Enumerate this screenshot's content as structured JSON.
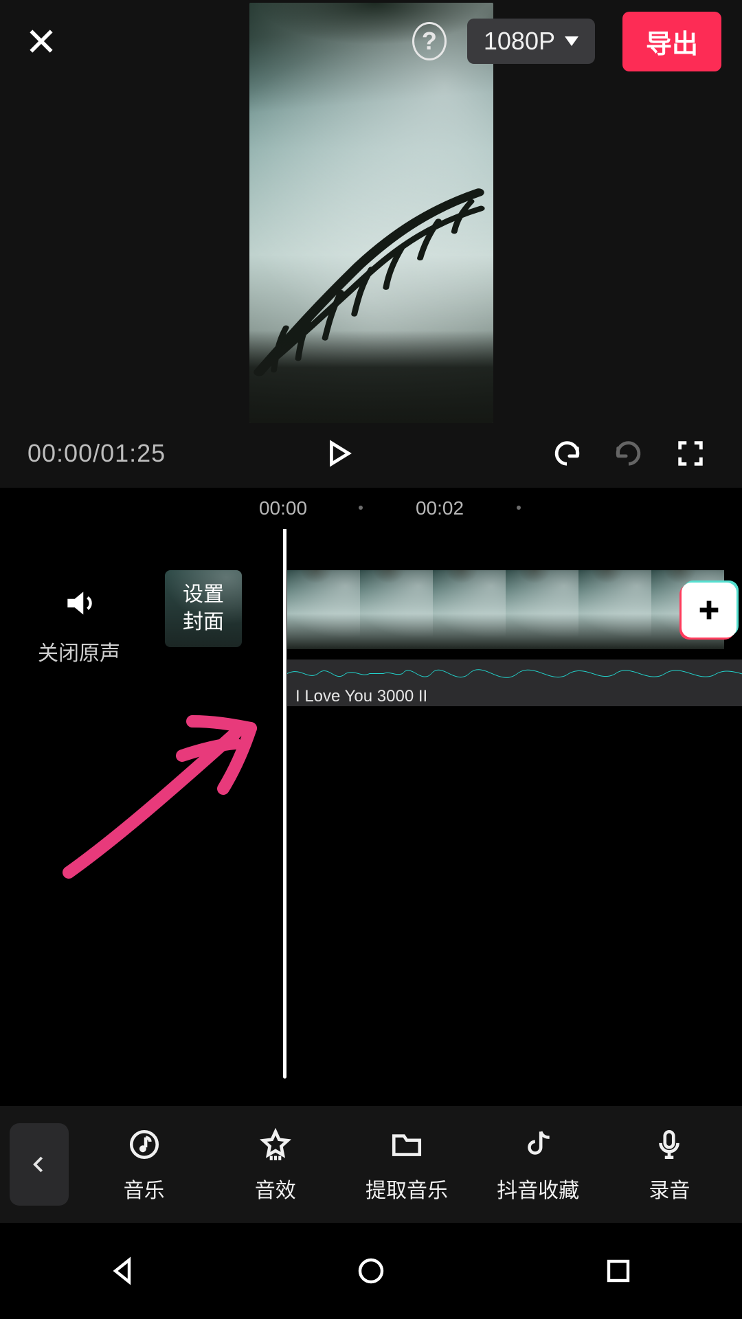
{
  "colors": {
    "accent": "#fd2c55",
    "waveform": "#22d6cf",
    "annotation": "#e83a7b"
  },
  "header": {
    "resolution_label": "1080P",
    "export_label": "导出"
  },
  "transport": {
    "current_time": "00:00",
    "total_time": "01:25",
    "timecode_display": "00:00/01:25"
  },
  "ruler": {
    "ticks": [
      "00:00",
      "00:02"
    ]
  },
  "timeline": {
    "mute_label": "关闭原声",
    "cover_label": "设置\n封面",
    "audio_clip_title": "I Love You 3000 II"
  },
  "toolbar": {
    "back_icon": "chevron-left",
    "items": [
      {
        "icon": "music-note-icon",
        "label": "音乐"
      },
      {
        "icon": "star-fx-icon",
        "label": "音效"
      },
      {
        "icon": "folder-icon",
        "label": "提取音乐"
      },
      {
        "icon": "douyin-icon",
        "label": "抖音收藏"
      },
      {
        "icon": "mic-icon",
        "label": "录音"
      }
    ]
  },
  "navbar": {
    "back": "◁",
    "home": "○",
    "recents": "□"
  }
}
